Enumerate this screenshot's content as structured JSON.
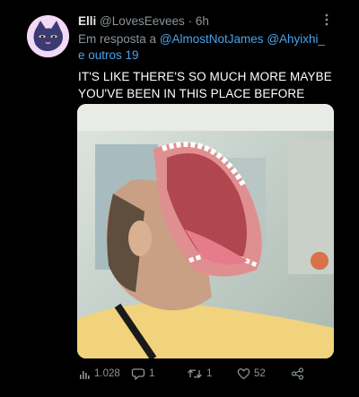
{
  "tweet": {
    "display_name": "Elli",
    "handle": "@LovesEevees",
    "separator": "·",
    "time": "6h",
    "more_icon": "more-vertical-icon",
    "reply_prefix": "Em resposta a",
    "reply_mention_1": "@AlmostNotJames",
    "reply_mention_2": "@Ahyixhi_",
    "reply_others": "e outros 19",
    "text": "IT'S LIKE THERE'S SO MUCH MORE MAYBE YOU'VE BEEN IN THIS PLACE BEFORE",
    "avatar_icon": "cat-avatar-icon",
    "media_icon": "meme-photo"
  },
  "actions": {
    "views": "1.028",
    "replies": "1",
    "retweets": "1",
    "likes": "52",
    "views_icon": "analytics-icon",
    "replies_icon": "reply-icon",
    "retweets_icon": "retweet-icon",
    "likes_icon": "heart-icon",
    "share_icon": "share-icon"
  },
  "colors": {
    "background": "#000000",
    "text": "#ffffff",
    "muted": "#8b949a",
    "link": "#4aa3ec",
    "avatar_background": "#f2d9f5",
    "avatar_cat": "#3c3a72"
  }
}
